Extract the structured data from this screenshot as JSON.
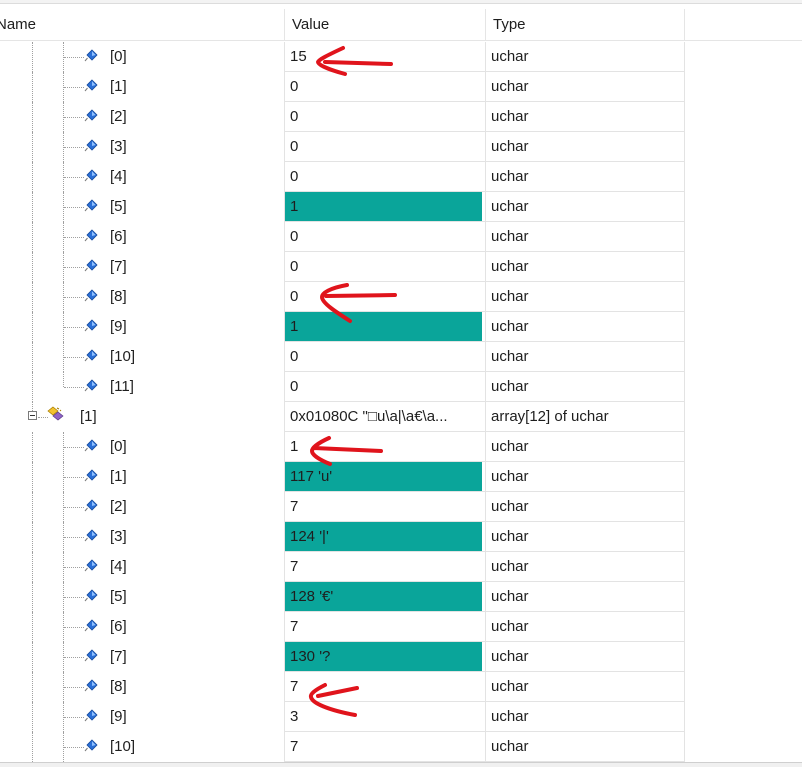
{
  "header": {
    "name": "Name",
    "value": "Value",
    "type": "Type"
  },
  "rows": [
    {
      "name": "[0]",
      "value": "15",
      "type": "uchar",
      "level": 2,
      "changed": false
    },
    {
      "name": "[1]",
      "value": "0",
      "type": "uchar",
      "level": 2,
      "changed": false
    },
    {
      "name": "[2]",
      "value": "0",
      "type": "uchar",
      "level": 2,
      "changed": false
    },
    {
      "name": "[3]",
      "value": "0",
      "type": "uchar",
      "level": 2,
      "changed": false
    },
    {
      "name": "[4]",
      "value": "0",
      "type": "uchar",
      "level": 2,
      "changed": false
    },
    {
      "name": "[5]",
      "value": "1",
      "type": "uchar",
      "level": 2,
      "changed": true
    },
    {
      "name": "[6]",
      "value": "0",
      "type": "uchar",
      "level": 2,
      "changed": false
    },
    {
      "name": "[7]",
      "value": "0",
      "type": "uchar",
      "level": 2,
      "changed": false
    },
    {
      "name": "[8]",
      "value": "0",
      "type": "uchar",
      "level": 2,
      "changed": false
    },
    {
      "name": "[9]",
      "value": "1",
      "type": "uchar",
      "level": 2,
      "changed": true
    },
    {
      "name": "[10]",
      "value": "0",
      "type": "uchar",
      "level": 2,
      "changed": false
    },
    {
      "name": "[11]",
      "value": "0",
      "type": "uchar",
      "level": 2,
      "changed": false,
      "lastChild": true
    },
    {
      "name": "[1]",
      "value": "0x01080C \"□u\\a|\\a€\\a...",
      "type": "array[12] of uchar",
      "level": 1,
      "changed": false,
      "expanded": true
    },
    {
      "name": "[0]",
      "value": "1",
      "type": "uchar",
      "level": 2,
      "changed": false
    },
    {
      "name": "[1]",
      "value": "117 'u'",
      "type": "uchar",
      "level": 2,
      "changed": true
    },
    {
      "name": "[2]",
      "value": "7",
      "type": "uchar",
      "level": 2,
      "changed": false
    },
    {
      "name": "[3]",
      "value": "124 '|'",
      "type": "uchar",
      "level": 2,
      "changed": true
    },
    {
      "name": "[4]",
      "value": "7",
      "type": "uchar",
      "level": 2,
      "changed": false
    },
    {
      "name": "[5]",
      "value": "128 '€'",
      "type": "uchar",
      "level": 2,
      "changed": true
    },
    {
      "name": "[6]",
      "value": "7",
      "type": "uchar",
      "level": 2,
      "changed": false
    },
    {
      "name": "[7]",
      "value": "130 '?",
      "type": "uchar",
      "level": 2,
      "changed": true
    },
    {
      "name": "[8]",
      "value": "7",
      "type": "uchar",
      "level": 2,
      "changed": false
    },
    {
      "name": "[9]",
      "value": "3",
      "type": "uchar",
      "level": 2,
      "changed": false
    },
    {
      "name": "[10]",
      "value": "7",
      "type": "uchar",
      "level": 2,
      "changed": false
    }
  ],
  "colors": {
    "changed_bg": "#0aa59a",
    "annotation": "#e0141c"
  },
  "icons": {
    "element": "field-diamond-icon",
    "array": "array-object-icon"
  }
}
